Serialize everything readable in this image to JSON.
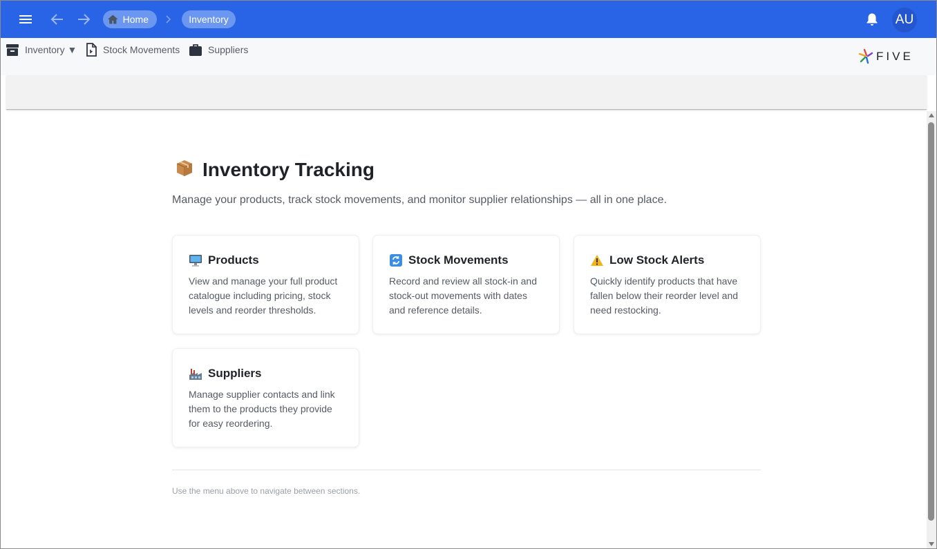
{
  "header": {
    "menu_icon": "hamburger-icon",
    "back_icon": "arrow-left-icon",
    "forward_icon": "arrow-right-icon",
    "breadcrumb": {
      "home_label": "Home",
      "home_icon": "home-icon",
      "separator_icon": "chevron-right-icon",
      "current_label": "Inventory"
    },
    "bell_icon": "bell-icon",
    "avatar_initials": "AU",
    "accent_color": "#2a64e6"
  },
  "toolbar": {
    "items": [
      {
        "label": "Inventory ▼",
        "icon": "archive-box-icon"
      },
      {
        "label": "Stock Movements",
        "icon": "document-icon"
      },
      {
        "label": "Suppliers",
        "icon": "briefcase-icon"
      }
    ],
    "logo_text": "FIVE"
  },
  "main": {
    "title_icon": "package-icon",
    "title": "Inventory Tracking",
    "subtitle": "Manage your products, track stock movements, and monitor supplier relationships — all in one place.",
    "cards": [
      {
        "icon": "computer-icon",
        "title": "Products",
        "description": "View and manage your full product catalogue including pricing, stock levels and reorder thresholds."
      },
      {
        "icon": "refresh-icon",
        "title": "Stock Movements",
        "description": "Record and review all stock-in and stock-out movements with dates and reference details."
      },
      {
        "icon": "warning-icon",
        "title": "Low Stock Alerts",
        "description": "Quickly identify products that have fallen below their reorder level and need restocking."
      },
      {
        "icon": "factory-icon",
        "title": "Suppliers",
        "description": "Manage supplier contacts and link them to the products they provide for easy reordering."
      }
    ],
    "footer_note": "Use the menu above to navigate between sections."
  }
}
